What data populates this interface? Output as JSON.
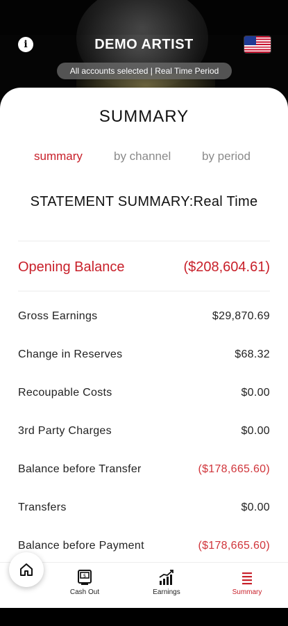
{
  "header": {
    "artist_name": "DEMO ARTIST",
    "accounts_label": "All accounts selected | Real Time Period"
  },
  "summary": {
    "title": "SUMMARY",
    "tabs": [
      {
        "label": "summary",
        "active": true
      },
      {
        "label": "by channel",
        "active": false
      },
      {
        "label": "by period",
        "active": false
      }
    ],
    "statement_heading": "STATEMENT SUMMARY:Real Time",
    "opening_balance": {
      "label": "Opening Balance",
      "value": "($208,604.61)"
    },
    "rows": [
      {
        "label": "Gross Earnings",
        "value": "$29,870.69",
        "negative": false
      },
      {
        "label": "Change in Reserves",
        "value": "$68.32",
        "negative": false
      },
      {
        "label": "Recoupable Costs",
        "value": "$0.00",
        "negative": false
      },
      {
        "label": "3rd Party Charges",
        "value": "$0.00",
        "negative": false
      },
      {
        "label": "Balance before Transfer",
        "value": "($178,665.60)",
        "negative": true
      },
      {
        "label": "Transfers",
        "value": "$0.00",
        "negative": false
      },
      {
        "label": "Balance before Payment",
        "value": "($178,665.60)",
        "negative": true
      }
    ]
  },
  "nav": {
    "items": [
      {
        "label": "Cash Out",
        "icon": "cash-out-icon"
      },
      {
        "label": "Earnings",
        "icon": "earnings-chart-icon"
      },
      {
        "label": "Summary",
        "icon": "summary-list-icon",
        "active": true
      }
    ],
    "home_icon": "home-icon"
  },
  "colors": {
    "accent_red": "#c8202a",
    "negative_red": "#d0343a",
    "inactive_tab": "#8a8a8a"
  }
}
